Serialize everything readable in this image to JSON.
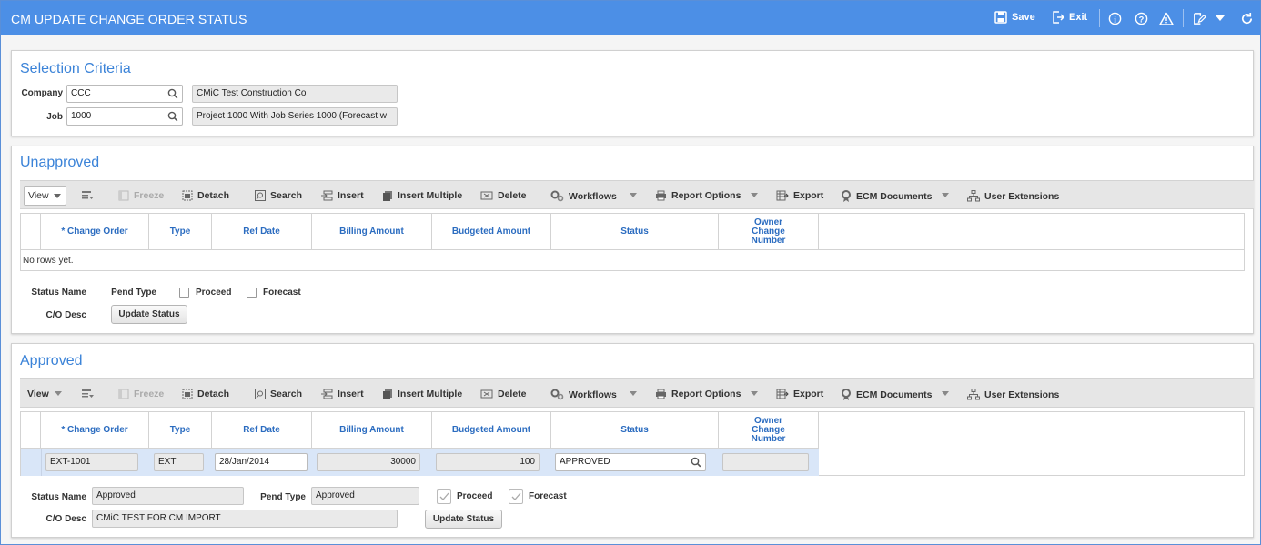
{
  "window": {
    "title": "CM UPDATE CHANGE ORDER STATUS",
    "save_label": "Save",
    "exit_label": "Exit"
  },
  "selection_criteria": {
    "title": "Selection Criteria",
    "company_label": "Company",
    "company_value": "CCC",
    "company_desc": "CMiC Test Construction Co",
    "job_label": "Job",
    "job_value": "1000",
    "job_desc": "Project 1000 With Job Series 1000 (Forecast w"
  },
  "toolbar": {
    "view": "View",
    "freeze": "Freeze",
    "detach": "Detach",
    "search": "Search",
    "insert": "Insert",
    "insert_multiple": "Insert Multiple",
    "delete": "Delete",
    "workflows": "Workflows",
    "report_options": "Report Options",
    "export": "Export",
    "ecm_documents": "ECM Documents",
    "user_extensions": "User Extensions"
  },
  "columns": [
    "* Change Order",
    "Type",
    "Ref Date",
    "Billing Amount",
    "Budgeted Amount",
    "Status",
    "Owner Change Number"
  ],
  "unapproved": {
    "title": "Unapproved",
    "empty_text": "No rows yet.",
    "status_name_label": "Status Name",
    "pend_type_label": "Pend Type",
    "proceed_label": "Proceed",
    "forecast_label": "Forecast",
    "co_desc_label": "C/O Desc",
    "update_button": "Update Status"
  },
  "approved": {
    "title": "Approved",
    "row": {
      "change_order": "EXT-1001",
      "type": "EXT",
      "ref_date": "28/Jan/2014",
      "billing_amount": "30000",
      "budgeted_amount": "100",
      "status": "APPROVED",
      "owner_change_number": ""
    },
    "status_name_label": "Status Name",
    "status_name_value": "Approved",
    "pend_type_label": "Pend Type",
    "pend_type_value": "Approved",
    "proceed_label": "Proceed",
    "proceed_checked": true,
    "forecast_label": "Forecast",
    "forecast_checked": true,
    "co_desc_label": "C/O Desc",
    "co_desc_value": "CMiC TEST FOR CM IMPORT",
    "update_button": "Update Status"
  },
  "colors": {
    "title_bar": "#4c8fe6",
    "panel_title": "#3b83d8",
    "column_header": "#2b6cc0",
    "selected_row": "#d9e6f8"
  }
}
